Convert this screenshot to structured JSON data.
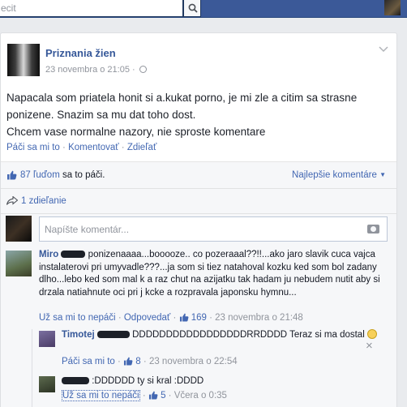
{
  "topbar": {
    "search_placeholder": "ecit",
    "search_icon": "search-icon"
  },
  "post": {
    "page_name": "Priznania žien",
    "date": "23 novembra o 21:05 ·",
    "text_lines": [
      "Napacala som priatela honit si a.kukat porno, je mi zle a citim sa strasne",
      "ponizene. Snazim sa mu dat toho dost.",
      "Chcem vase normalne nazory, nie sproste komentare"
    ],
    "actions": {
      "like": "Páči sa mi to",
      "comment": "Komentovať",
      "share": "Zdieľať",
      "dot": "·"
    },
    "likes_count": "87 ľuďom",
    "likes_suffix": " sa to páči.",
    "best_comments": "Najlepšie komentáre",
    "shares": "1 zdieľanie",
    "comment_placeholder": "Napíšte komentár..."
  },
  "comments": [
    {
      "name": "Miro",
      "text": " ponizenaaaa...booooze.. co pozeraaal??!!...ako jaro slavik cuca vajca instalaterovi pri umyvadle???...ja som si tiez natahoval kozku ked som bol zadany dlho...lebo ked som mal k   a raz chut na azijatku tak hadam ju nebudem nutit aby si drzala natiahnute oci pri j   kcke a rozpravala japonsku hymnu...",
      "unlike": "Už sa mi to nepáči",
      "reply": "Odpovedať",
      "likes": "169",
      "date": "23 novembra o 21:48"
    },
    {
      "name": "Timotej",
      "text": " DDDDDDDDDDDDDDDDDRRDDDD Teraz si ma dostal",
      "like": "Páči sa mi to",
      "likes": "8",
      "date": "23 novembra o 22:54"
    },
    {
      "name": "",
      "text": " :DDDDDD ty si kral :DDDD",
      "unlike": "Už sa mi to nepáči",
      "likes": "5",
      "date": "Včera o 0:35",
      "close": "×"
    }
  ],
  "colors": {
    "brand": "#3b5998",
    "link": "#4267b2",
    "name": "#365899",
    "meta": "#90949c"
  }
}
